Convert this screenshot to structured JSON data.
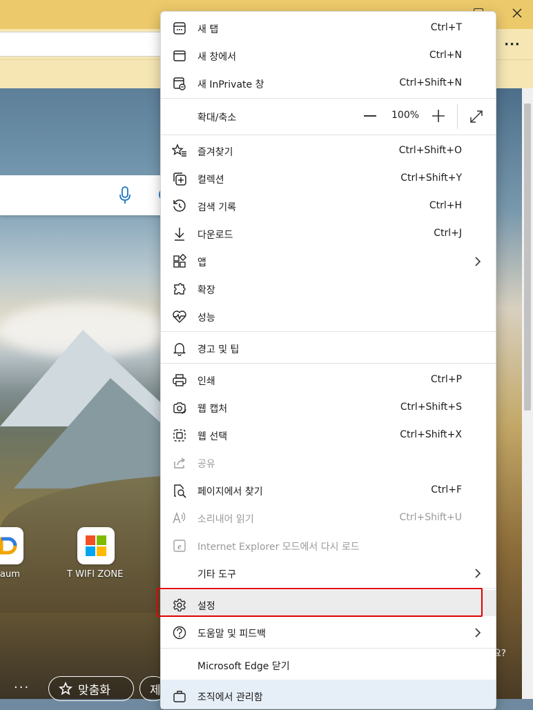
{
  "browser": {
    "more_label": "···"
  },
  "page": {
    "tiles": [
      {
        "label": "aum",
        "icon": "daum-logo-icon"
      },
      {
        "label": "T WIFI ZONE",
        "icon": "microsoft-logo-icon"
      }
    ],
    "bottom_dots": "···",
    "customize_label": "맞춤화",
    "next_pill_label": "제",
    "corner_text": "요?",
    "ms_colors": [
      "#f25022",
      "#7fba00",
      "#00a4ef",
      "#ffb900"
    ]
  },
  "menu": {
    "items": [
      {
        "label": "새 탭",
        "shortcut": "Ctrl+T",
        "icon": "new-tab-icon"
      },
      {
        "label": "새 창에서",
        "shortcut": "Ctrl+N",
        "icon": "new-window-icon"
      },
      {
        "label": "새 InPrivate 창",
        "shortcut": "Ctrl+Shift+N",
        "icon": "inprivate-window-icon"
      },
      {
        "label": "즐겨찾기",
        "shortcut": "Ctrl+Shift+O",
        "icon": "favorites-icon"
      },
      {
        "label": "컬렉션",
        "shortcut": "Ctrl+Shift+Y",
        "icon": "collections-icon"
      },
      {
        "label": "검색 기록",
        "shortcut": "Ctrl+H",
        "icon": "history-icon"
      },
      {
        "label": "다운로드",
        "shortcut": "Ctrl+J",
        "icon": "download-icon"
      },
      {
        "label": "앱",
        "shortcut": "",
        "icon": "apps-icon"
      },
      {
        "label": "확장",
        "shortcut": "",
        "icon": "extensions-icon"
      },
      {
        "label": "성능",
        "shortcut": "",
        "icon": "performance-icon"
      },
      {
        "label": "경고 및 팁",
        "shortcut": "",
        "icon": "bell-icon"
      },
      {
        "label": "인쇄",
        "shortcut": "Ctrl+P",
        "icon": "print-icon"
      },
      {
        "label": "웹 캡처",
        "shortcut": "Ctrl+Shift+S",
        "icon": "web-capture-icon"
      },
      {
        "label": "웹 선택",
        "shortcut": "Ctrl+Shift+X",
        "icon": "web-select-icon"
      },
      {
        "label": "공유",
        "shortcut": "",
        "icon": "share-icon"
      },
      {
        "label": "페이지에서 찾기",
        "shortcut": "Ctrl+F",
        "icon": "find-in-page-icon"
      },
      {
        "label": "소리내어 읽기",
        "shortcut": "Ctrl+Shift+U",
        "icon": "read-aloud-icon"
      },
      {
        "label": "Internet Explorer 모드에서 다시 로드",
        "shortcut": "",
        "icon": "ie-mode-icon"
      },
      {
        "label": "기타 도구",
        "shortcut": "",
        "icon": ""
      },
      {
        "label": "설정",
        "shortcut": "",
        "icon": "gear-icon"
      },
      {
        "label": "도움말 및 피드백",
        "shortcut": "",
        "icon": "help-icon"
      },
      {
        "label": "Microsoft Edge 닫기",
        "shortcut": "",
        "icon": ""
      },
      {
        "label": "조직에서 관리함",
        "shortcut": "",
        "icon": "briefcase-icon"
      }
    ],
    "zoom": {
      "label": "확대/축소",
      "value": "100%"
    }
  }
}
